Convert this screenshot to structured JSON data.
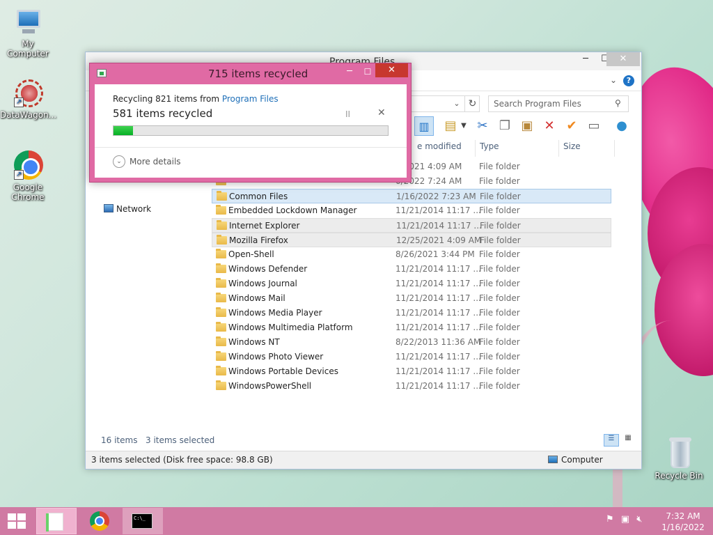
{
  "desktop": {
    "icons": [
      {
        "label": "My Computer"
      },
      {
        "label": "DataWagon..."
      },
      {
        "label": "Google Chrome"
      },
      {
        "label": "Recycle Bin"
      }
    ]
  },
  "explorer": {
    "title": "Program Files",
    "minimize": "─",
    "maximize": "☐",
    "close": "✕",
    "help": "?",
    "address_dropdown": "⌄",
    "refresh": "↻",
    "search_placeholder": "Search Program Files",
    "columns": {
      "date": "e modified",
      "type": "Type",
      "size": "Size"
    },
    "nav": {
      "network": "Network"
    },
    "rows": [
      {
        "name": "",
        "date": "5/2021 4:09 AM",
        "type": "File folder",
        "selected": false
      },
      {
        "name": "",
        "date": "0/2022 7:24 AM",
        "type": "File folder",
        "selected": false
      },
      {
        "name": "Common Files",
        "date": "1/16/2022 7:23 AM",
        "type": "File folder",
        "selected": true
      },
      {
        "name": "Embedded Lockdown Manager",
        "date": "11/21/2014 11:17 ...",
        "type": "File folder",
        "selected": false
      },
      {
        "name": "Internet Explorer",
        "date": "11/21/2014 11:17 ...",
        "type": "File folder",
        "selected": true
      },
      {
        "name": "Mozilla Firefox",
        "date": "12/25/2021 4:09 AM",
        "type": "File folder",
        "selected": true
      },
      {
        "name": "Open-Shell",
        "date": "8/26/2021 3:44 PM",
        "type": "File folder",
        "selected": false
      },
      {
        "name": "Windows Defender",
        "date": "11/21/2014 11:17 ...",
        "type": "File folder",
        "selected": false
      },
      {
        "name": "Windows Journal",
        "date": "11/21/2014 11:17 ...",
        "type": "File folder",
        "selected": false
      },
      {
        "name": "Windows Mail",
        "date": "11/21/2014 11:17 ...",
        "type": "File folder",
        "selected": false
      },
      {
        "name": "Windows Media Player",
        "date": "11/21/2014 11:17 ...",
        "type": "File folder",
        "selected": false
      },
      {
        "name": "Windows Multimedia Platform",
        "date": "11/21/2014 11:17 ...",
        "type": "File folder",
        "selected": false
      },
      {
        "name": "Windows NT",
        "date": "8/22/2013 11:36 AM",
        "type": "File folder",
        "selected": false
      },
      {
        "name": "Windows Photo Viewer",
        "date": "11/21/2014 11:17 ...",
        "type": "File folder",
        "selected": false
      },
      {
        "name": "Windows Portable Devices",
        "date": "11/21/2014 11:17 ...",
        "type": "File folder",
        "selected": false
      },
      {
        "name": "WindowsPowerShell",
        "date": "11/21/2014 11:17 ...",
        "type": "File folder",
        "selected": false
      }
    ],
    "item_count": "16 items",
    "selected_count": "3 items selected",
    "status_left": "3 items selected (Disk free space: 98.8 GB)",
    "status_right": "Computer"
  },
  "dialog": {
    "title": "715 items recycled",
    "minimize": "─",
    "maximize": "☐",
    "close": "✕",
    "desc_prefix": "Recycling 821 items from ",
    "desc_link": "Program Files",
    "status": "581 items recycled",
    "pause": "II",
    "cancel": "✕",
    "progress": 0.07,
    "more_details": "More details"
  },
  "taskbar": {
    "cmd_text": "C:\\_",
    "clock_time": "7:32 AM",
    "clock_date": "1/16/2022"
  },
  "colors": {
    "taskbar": "#d07aa3",
    "dialog_frame": "#e06aa4",
    "progress_fill": "#06b025",
    "link": "#1e6fb8"
  }
}
